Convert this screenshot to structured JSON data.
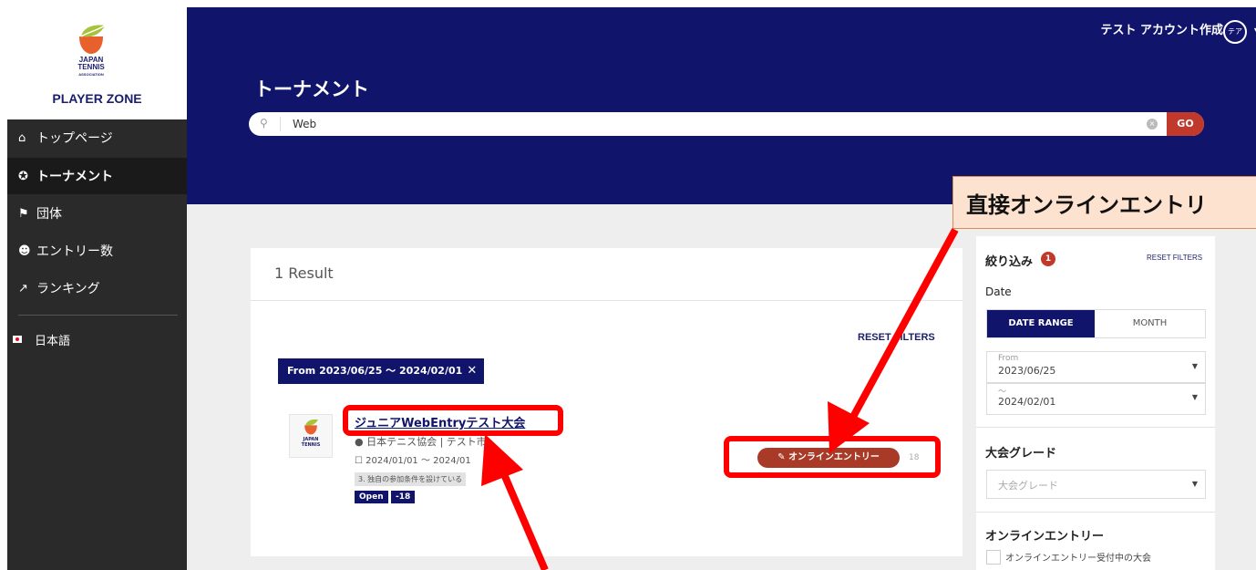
{
  "brand": {
    "logo_line1": "JAPAN",
    "logo_line2": "TENNIS",
    "logo_line3": "ASSOCIATION",
    "subtitle": "PLAYER ZONE"
  },
  "sidebar": {
    "items": [
      {
        "label": "トップページ",
        "icon": "home-icon"
      },
      {
        "label": "トーナメント",
        "icon": "medal-icon"
      },
      {
        "label": "団体",
        "icon": "flag-icon"
      },
      {
        "label": "エントリー数",
        "icon": "users-icon"
      },
      {
        "label": "ランキング",
        "icon": "chart-icon"
      }
    ],
    "language": "日本語"
  },
  "header": {
    "account_label": "テスト アカウント作成",
    "avatar_text": "テア",
    "page_title": "トーナメント",
    "search": {
      "value": "Web",
      "go_label": "GO"
    }
  },
  "results": {
    "count_label": "1 Result",
    "reset_filters": "RESET FILTERS",
    "chip_label": "From 2023/06/25 ～ 2024/02/01",
    "tournament": {
      "logo_line1": "JAPAN",
      "logo_line2": "TENNIS",
      "title": "ジュニアWebEntryテスト大会",
      "location": "日本テニス協会 | テスト市",
      "dates": "2024/01/01 ～ 2024/01",
      "condition": "3. 独自の参加条件を設けている",
      "tags": [
        "Open",
        "-18"
      ],
      "entry_button": "オンラインエントリー",
      "side_number": "18"
    }
  },
  "filters": {
    "title": "絞り込み",
    "badge_count": "1",
    "reset": "RESET FILTERS",
    "date_label": "Date",
    "toggle": [
      "DATE RANGE",
      "MONTH"
    ],
    "from_label": "From",
    "from_value": "2023/06/25",
    "to_label": "～",
    "to_value": "2024/02/01",
    "grade_title": "大会グレード",
    "grade_placeholder": "大会グレード",
    "online_title": "オンラインエントリー",
    "online_checkbox_label": "オンラインエントリー受付中の大会"
  },
  "annotation": {
    "callout_text": "直接オンラインエントリ"
  },
  "colors": {
    "navy": "#11146b",
    "accent_red": "#c0392b",
    "annotation_red": "#ff0000",
    "callout_bg": "#fde2cf"
  }
}
